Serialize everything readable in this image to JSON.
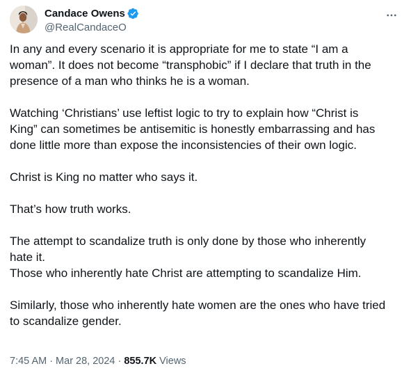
{
  "author": {
    "display_name": "Candace Owens",
    "handle": "@RealCandaceO",
    "verified_icon": "verified-badge-icon",
    "verified_color": "#1d9bf0"
  },
  "more_icon": "more-horizontal-icon",
  "body": {
    "paragraphs": [
      [
        "In any and every scenario it is appropriate for me to state “I am a",
        "woman”. It does not become “transphobic” if I declare that truth in the",
        "presence of a man who thinks he is a woman."
      ],
      [
        "Watching ‘Christians’ use leftist logic to try to explain how “Christ is",
        "King” can sometimes be antisemitic is honestly embarrassing and has",
        "done little more than expose the inconsistencies of their own logic."
      ],
      [
        "Christ is King no matter who says it."
      ],
      [
        "That’s how truth works."
      ],
      [
        "The attempt to scandalize truth is only done by those who inherently",
        "hate it.",
        "Those who inherently hate Christ are attempting to scandalize Him."
      ],
      [
        "Similarly, those who inherently hate women are the ones who have tried",
        "to scandalize gender."
      ]
    ]
  },
  "meta": {
    "time": "7:45 AM",
    "separator": "·",
    "date": "Mar 28, 2024",
    "views_count": "855.7K",
    "views_label": "Views"
  }
}
